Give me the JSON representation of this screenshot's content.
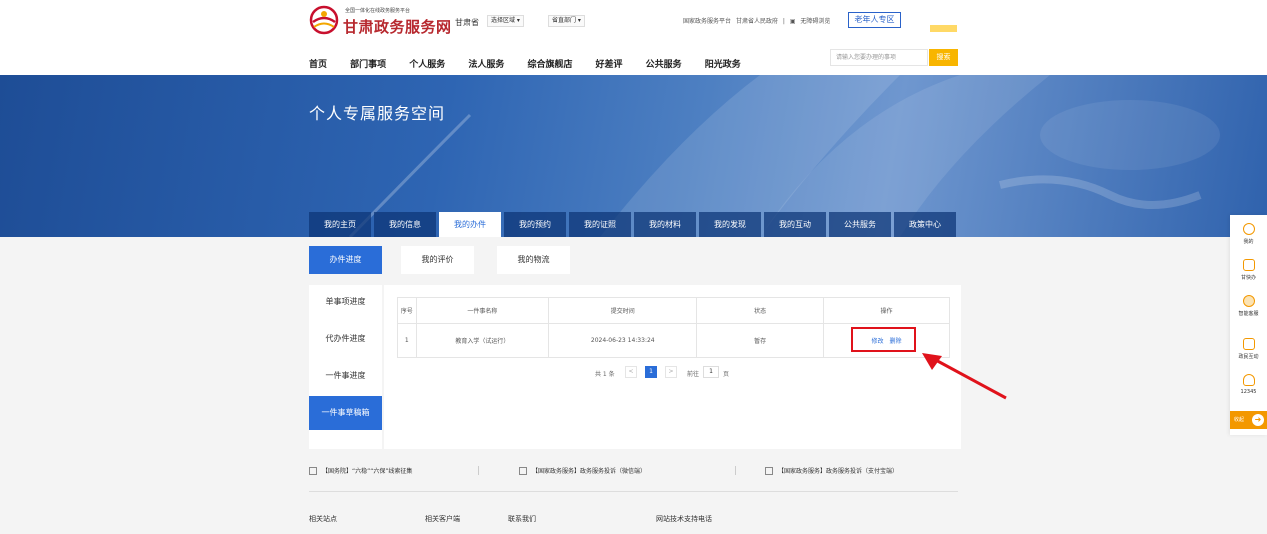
{
  "header": {
    "logo_small": "全国一体化在线政务服务平台",
    "logo_big": "甘肃政务服务网",
    "province": "甘肃省",
    "region_select": "选择区域",
    "dept_select": "省直部门",
    "top_links": [
      "国家政务服务平台",
      "甘肃省人民政府",
      "|",
      "无障碍浏览"
    ],
    "senior_zone": "老年人专区",
    "nav": [
      "首页",
      "部门事项",
      "个人服务",
      "法人服务",
      "综合旗舰店",
      "好差评",
      "公共服务",
      "阳光政务"
    ],
    "search_placeholder": "请输入您要办理的事项",
    "search_button": "搜索"
  },
  "banner": {
    "title": "个人专属服务空间"
  },
  "tabs": [
    "我的主页",
    "我的信息",
    "我的办件",
    "我的预约",
    "我的证照",
    "我的材料",
    "我的发现",
    "我的互动",
    "公共服务",
    "政策中心"
  ],
  "active_tab": "我的办件",
  "subtabs": [
    "办件进度",
    "我的评价",
    "我的物流"
  ],
  "sidebar": [
    "单事项进度",
    "代办件进度",
    "一件事进度",
    "一件事草稿箱"
  ],
  "table": {
    "headers": [
      "序号",
      "一件事名称",
      "提交时间",
      "状态",
      "操作"
    ],
    "rows": [
      {
        "index": "1",
        "name": "教育入学（试运行）",
        "time": "2024-06-23 14:33:24",
        "status": "暂存",
        "edit": "修改",
        "delete": "删除"
      }
    ]
  },
  "pager": {
    "total": "共 1 条",
    "prev": "<",
    "current": "1",
    "next": ">",
    "goto": "前往",
    "page_value": "1",
    "page_unit": "页"
  },
  "footer": {
    "links": [
      "【国务院】“六稳”“六保”线索征集",
      "【国家政务服务】政务服务投诉（微信端）",
      "【国家政务服务】政务服务投诉（支付宝端）"
    ],
    "columns": [
      "相关站点",
      "相关客户端",
      "联系我们",
      "网站技术支持电话"
    ]
  },
  "float_bar": {
    "items": [
      "我的",
      "甘快办",
      "智能客服",
      "政民互动",
      "12345"
    ],
    "collapse": "收起"
  },
  "colors": {
    "accent": "#2a6dd8",
    "highlight": "#e0121b",
    "search_button": "#f8b500",
    "float_accent": "#f39800"
  }
}
